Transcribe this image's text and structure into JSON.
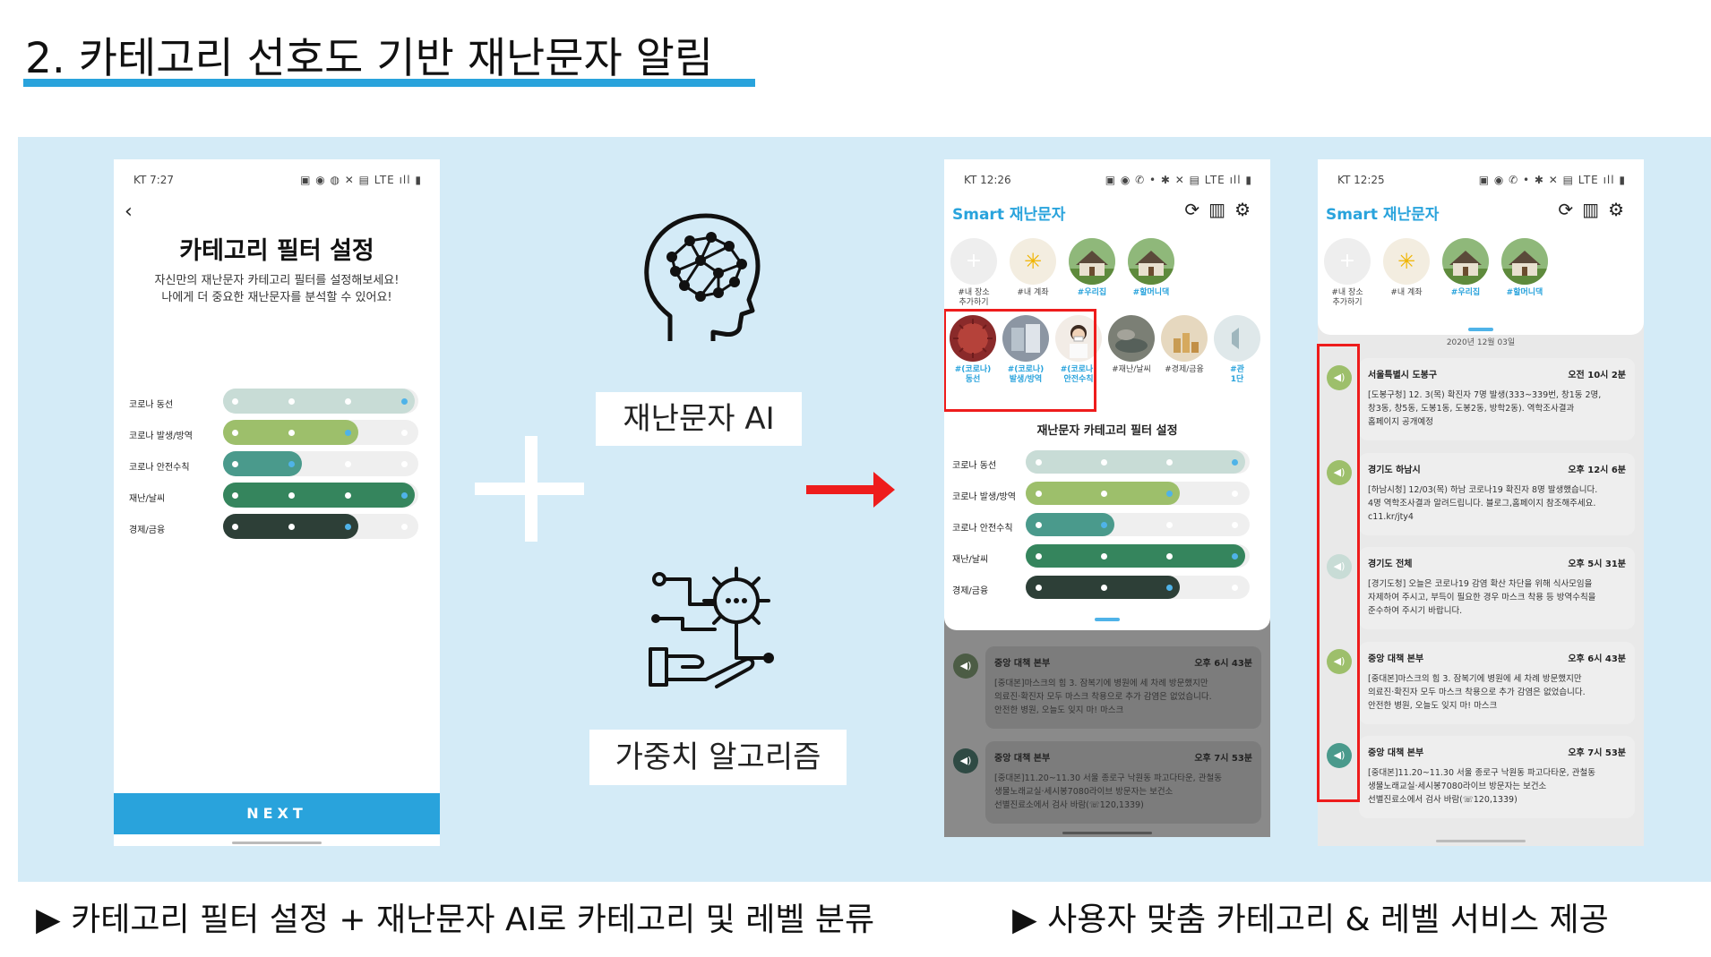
{
  "heading": {
    "title": "2. 카테고리 선호도 기반 재난문자 알림"
  },
  "colors": {
    "accent": "#29a3dc",
    "highlight_red": "#ee1c1c",
    "stage_bg": "#d4ebf7",
    "slider_1": "#c8dcd6",
    "slider_2": "#9dbf6b",
    "slider_3": "#4a9a8c",
    "slider_4": "#35855d",
    "slider_5": "#2d3f37"
  },
  "phone1": {
    "status_time": "KT 7:27",
    "status_icons": "▣ ◉ ◍        ✕ ▤ LTE ıll ▮",
    "back_icon": "‹",
    "title": "카테고리 필터 설정",
    "subtitle_1": "자신만의 재난문자 카테고리 필터를 설정해보세요!",
    "subtitle_2": "나에게 더 중요한 재난문자를 분석할 수 있어요!",
    "sliders": [
      {
        "label": "코로나 동선",
        "level": 4
      },
      {
        "label": "코로나 발생/방역",
        "level": 3
      },
      {
        "label": "코로나 안전수칙",
        "level": 2
      },
      {
        "label": "재난/날씨",
        "level": 4
      },
      {
        "label": "경제/금융",
        "level": 3
      }
    ],
    "next_label": "NEXT"
  },
  "middle": {
    "ai_label": "재난문자 AI",
    "algo_label": "가중치 알고리즘"
  },
  "app": {
    "title": "Smart 재난문자",
    "icons": [
      "refresh-icon",
      "chart-icon",
      "gear-icon"
    ],
    "places": [
      {
        "label_1": "#내 장소",
        "label_2": "추가하기",
        "icon": "+"
      },
      {
        "label_1": "#내 계좌",
        "label_2": "",
        "icon": "✳"
      },
      {
        "label_1": "#우리집",
        "label_2": "",
        "icon": "house"
      },
      {
        "label_1": "#할머니댁",
        "label_2": "",
        "icon": "house"
      }
    ],
    "categories": [
      {
        "label_1": "#(코로나)",
        "label_2": "동선"
      },
      {
        "label_1": "#(코로나)",
        "label_2": "발생/방역"
      },
      {
        "label_1": "#(코로나)",
        "label_2": "안전수칙"
      },
      {
        "label_1": "#재난/날씨",
        "label_2": ""
      },
      {
        "label_1": "#경제/금융",
        "label_2": ""
      },
      {
        "label_1": "#관",
        "label_2": "1단"
      }
    ]
  },
  "phone2": {
    "status_time": "KT 12:26",
    "status_icons": "▣ ◉ ✆ •      ✱ ✕ ▤ LTE ıll ▮",
    "filter_title": "재난문자 카테고리 필터 설정",
    "sliders": [
      {
        "label": "코로나 동선",
        "level": 4
      },
      {
        "label": "코로나 발생/방역",
        "level": 3
      },
      {
        "label": "코로나 안전수칙",
        "level": 2
      },
      {
        "label": "재난/날씨",
        "level": 4
      },
      {
        "label": "경제/금융",
        "level": 3
      }
    ],
    "messages": [
      {
        "sender": "중앙 대책 본부",
        "time": "오후 6시 43분",
        "line1": "[중대본]마스크의 힘 3. 잠복기에 병원에 세 차례 방문했지만",
        "line2": "의료진·확진자 모두 마스크 착용으로 추가 감염은 없었습니다.",
        "line3": "안전한 병원, 오늘도 잊지 마! 마스크"
      },
      {
        "sender": "중앙 대책 본부",
        "time": "오후 7시 53분",
        "line1": "[중대본]11.20~11.30 서울 종로구 낙원동 파고다타운, 관철동",
        "line2": "생물노래교실·세시봉7080라이브 방문자는 보건소",
        "line3": "선별진료소에서 검사 바람(☏120,1339)"
      }
    ]
  },
  "phone3": {
    "status_time": "KT 12:25",
    "status_icons": "▣ ◉ ✆ •      ✱ ✕ ▤ LTE ıll ▮",
    "date_header": "2020년 12월 03일",
    "messages": [
      {
        "sender": "서울특별시 도봉구",
        "time": "오전 10시 2분",
        "line1": "[도봉구청] 12. 3(목) 확진자 7명 발생(333~339번, 창1동 2명,",
        "line2": "창3동, 창5동, 도봉1동, 도봉2동, 방학2동). 역학조사결과",
        "line3": "홈페이지 공개예정",
        "level_color": "#9dbf6b"
      },
      {
        "sender": "경기도 하남시",
        "time": "오후 12시 6분",
        "line1": "[하남시청] 12/03(목) 하남 코로나19 확진자 8명 발생했습니다.",
        "line2": "4명 역학조사결과 알려드립니다. 블로그,홈페이지 참조해주세요.",
        "line3": "c11.kr/jty4",
        "level_color": "#9dbf6b"
      },
      {
        "sender": "경기도 전체",
        "time": "오후 5시 31분",
        "line1": "[경기도청] 오늘은 코로나19 감염 확산 차단을 위해 식사모임을",
        "line2": "자제하여 주시고, 부득이 필요한 경우 마스크 착용 등 방역수칙을",
        "line3": "준수하여 주시기 바랍니다.",
        "level_color": "#c8dcd6"
      },
      {
        "sender": "중앙 대책 본부",
        "time": "오후 6시 43분",
        "line1": "[중대본]마스크의 힘 3. 잠복기에 병원에 세 차례 방문했지만",
        "line2": "의료진·확진자 모두 마스크 착용으로 추가 감염은 없었습니다.",
        "line3": "안전한 병원, 오늘도 잊지 마! 마스크",
        "level_color": "#9dbf6b"
      },
      {
        "sender": "중앙 대책 본부",
        "time": "오후 7시 53분",
        "line1": "[중대본]11.20~11.30 서울 종로구 낙원동 파고다타운, 관철동",
        "line2": "생물노래교실·세시봉7080라이브 방문자는 보건소",
        "line3": "선별진료소에서 검사 바람(☏120,1339)",
        "level_color": "#4a9a8c"
      }
    ]
  },
  "captions": {
    "left": "▶ 카테고리 필터 설정 + 재난문자 AI로 카테고리 및 레벨 분류",
    "right": "▶ 사용자 맞춤 카테고리 & 레벨 서비스 제공"
  }
}
